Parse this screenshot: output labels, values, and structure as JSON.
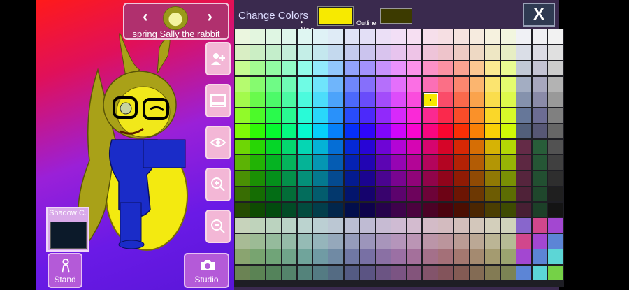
{
  "character": {
    "name": "spring Sally the rabbit",
    "prev_icon": "chevron-left-icon",
    "next_icon": "chevron-right-icon"
  },
  "left_panel": {
    "shadow_label": "Shadow C.",
    "shadow_color": "#0c1a2a",
    "stand_label": "Stand",
    "studio_label": "Studio",
    "side_buttons": [
      "add-character-icon",
      "background-icon",
      "eye-icon",
      "zoom-in-icon",
      "zoom-out-icon"
    ]
  },
  "colors_panel": {
    "title": "Change Colors",
    "main_label": "Main",
    "outline_label": "Outline",
    "main_color": "#f7ea00",
    "outline_color": "#3c3a00",
    "close_label": "X"
  }
}
